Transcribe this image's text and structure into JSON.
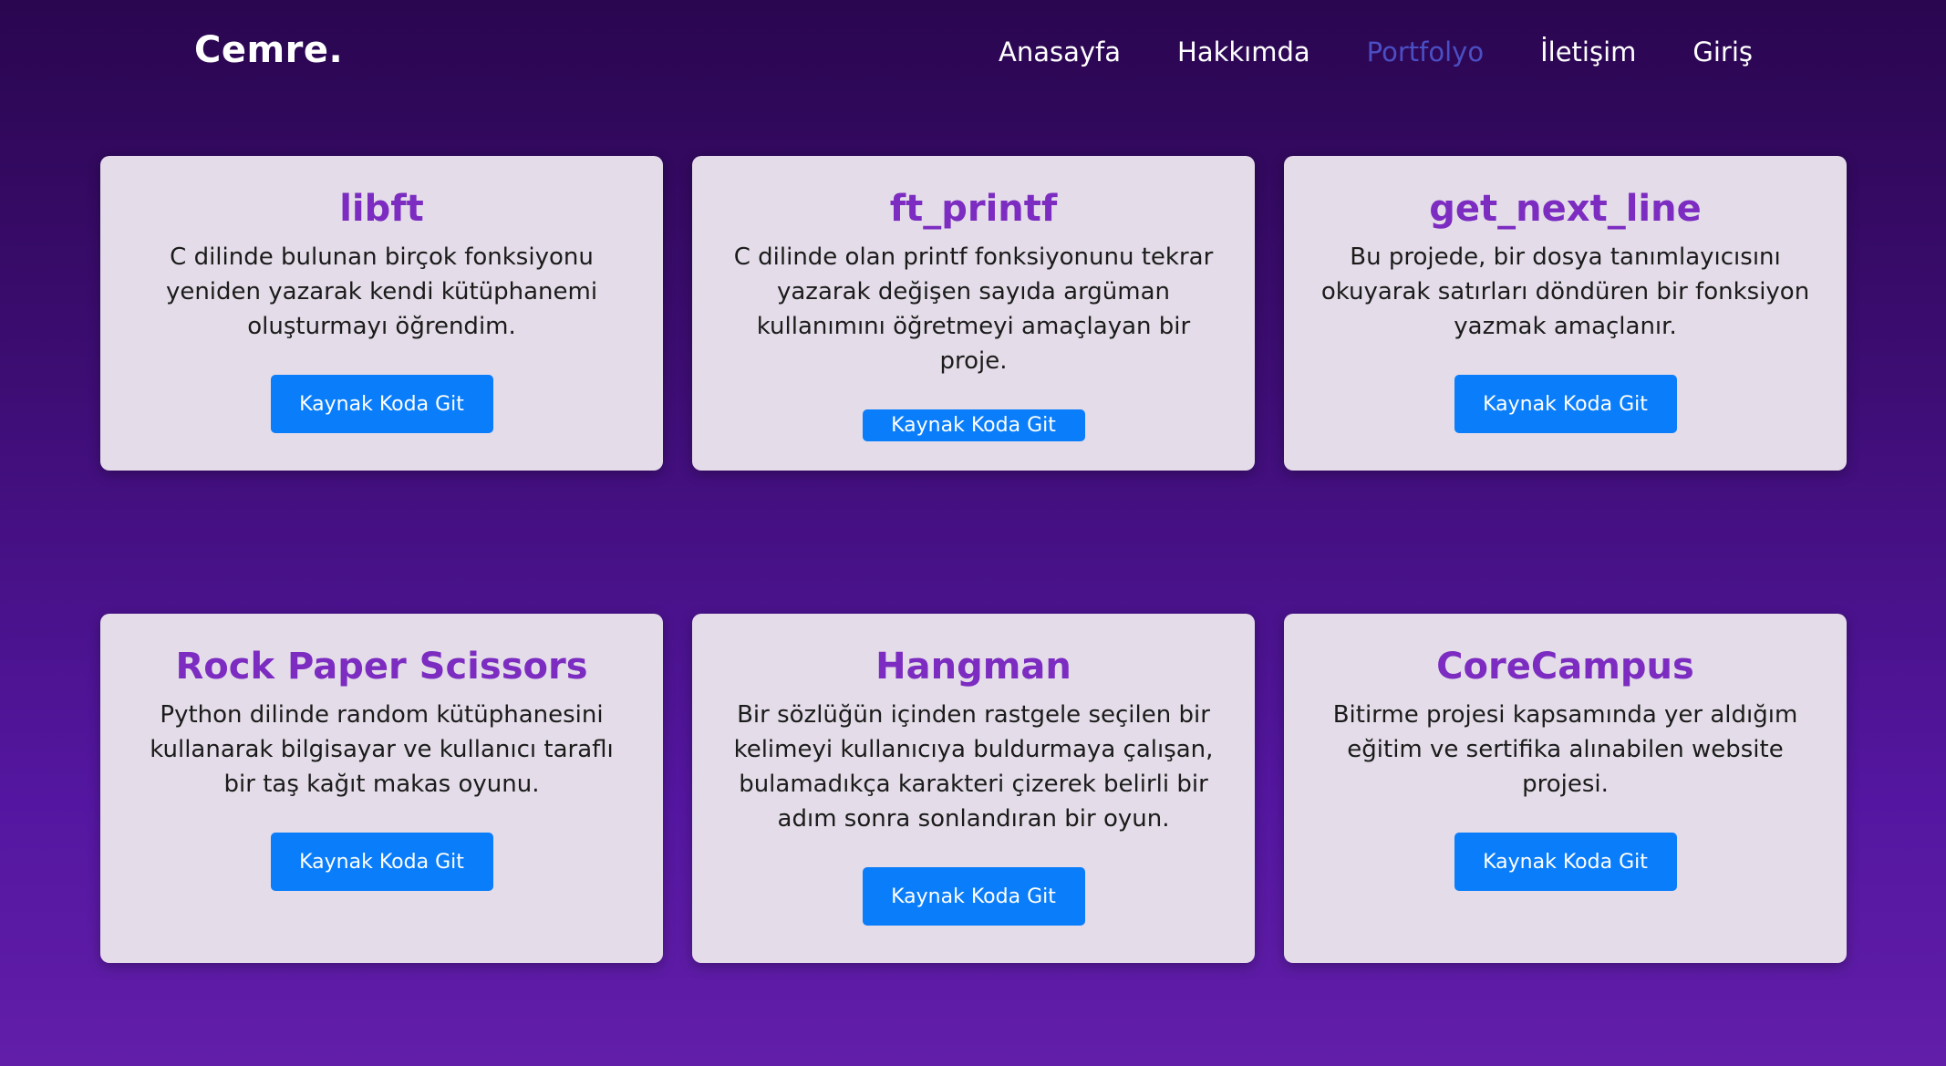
{
  "nav": {
    "logo": "Cemre.",
    "links": [
      {
        "label": "Anasayfa",
        "active": false
      },
      {
        "label": "Hakkımda",
        "active": false
      },
      {
        "label": "Portfolyo",
        "active": true
      },
      {
        "label": "İletişim",
        "active": false
      },
      {
        "label": "Giriş",
        "active": false
      }
    ]
  },
  "colors": {
    "accent_title": "#7c2cc0",
    "button": "#0a7dfa",
    "active_link": "#4b4fc4",
    "card_bg": "#e4dde9"
  },
  "projects": [
    {
      "title": "libft",
      "description": "C dilinde bulunan birçok fonksiyonu yeniden yazarak kendi kütüphanemi oluşturmayı öğrendim.",
      "button": "Kaynak Koda Git"
    },
    {
      "title": "ft_printf",
      "description": "C dilinde olan printf fonksiyonunu tekrar yazarak değişen sayıda argüman kullanımını öğretmeyi amaçlayan bir proje.",
      "button": "Kaynak Koda Git"
    },
    {
      "title": "get_next_line",
      "description": "Bu projede, bir dosya tanımlayıcısını okuyarak satırları döndüren bir fonksiyon yazmak amaçlanır.",
      "button": "Kaynak Koda Git"
    },
    {
      "title": "Rock Paper Scissors",
      "description": "Python dilinde random kütüphanesini kullanarak bilgisayar ve kullanıcı taraflı bir taş kağıt makas oyunu.",
      "button": "Kaynak Koda Git"
    },
    {
      "title": "Hangman",
      "description": "Bir sözlüğün içinden rastgele seçilen bir kelimeyi kullanıcıya buldurmaya çalışan, bulamadıkça karakteri çizerek belirli bir adım sonra sonlandıran bir oyun.",
      "button": "Kaynak Koda Git"
    },
    {
      "title": "CoreCampus",
      "description": "Bitirme projesi kapsamında yer aldığım eğitim ve sertifika alınabilen website projesi.",
      "button": "Kaynak Koda Git"
    }
  ]
}
